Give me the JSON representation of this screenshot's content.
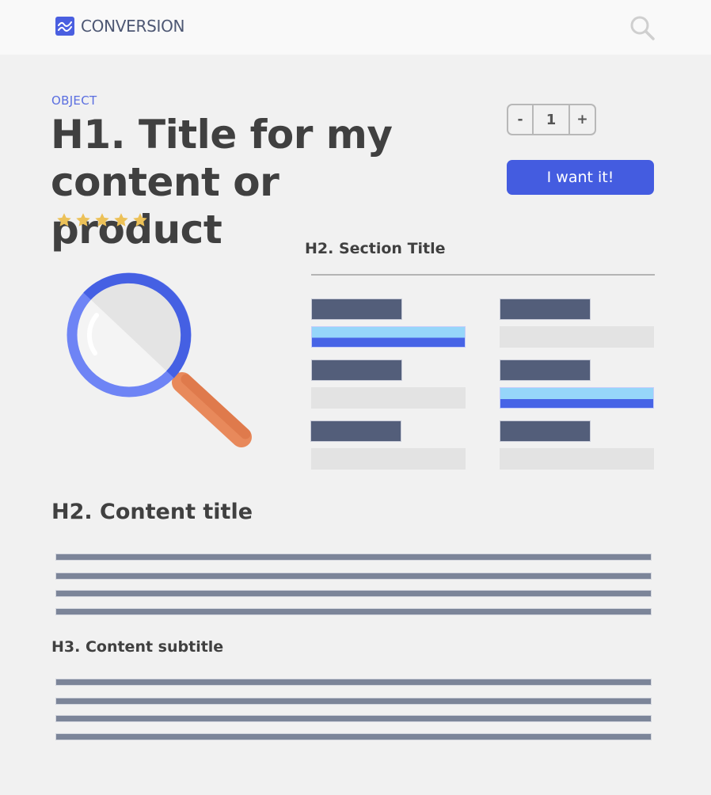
{
  "header": {
    "brand": "CONVERSION",
    "logo_icon": "chart-wave-icon",
    "search_icon": "search-icon"
  },
  "product": {
    "eyebrow": "OBJECT",
    "title": "H1. Title for my content or product",
    "rating": {
      "value": 5,
      "max": 5
    },
    "quantity": {
      "decrement_label": "-",
      "value": "1",
      "increment_label": "+"
    },
    "cta_label": "I want it!"
  },
  "section": {
    "title": "H2. Section Title",
    "options": [
      {
        "column": 1,
        "row": 1,
        "selected": true
      },
      {
        "column": 2,
        "row": 1,
        "selected": false
      },
      {
        "column": 1,
        "row": 2,
        "selected": false
      },
      {
        "column": 2,
        "row": 2,
        "selected": true
      },
      {
        "column": 1,
        "row": 3,
        "selected": false
      },
      {
        "column": 2,
        "row": 3,
        "selected": false
      }
    ]
  },
  "content": {
    "title": "H2. Content title",
    "paragraph_lines": 4,
    "subtitle": "H3. Content subtitle",
    "subtitle_paragraph_lines": 4
  },
  "colors": {
    "accent": "#445ce0",
    "eyebrow": "#5a6ee0",
    "star": "#ecc158",
    "placeholder_dark": "#535e7a",
    "placeholder_text": "#7c8599",
    "selected_light": "#96d6fa",
    "selected_dark": "#4764e6",
    "handle": "#e8895b"
  }
}
